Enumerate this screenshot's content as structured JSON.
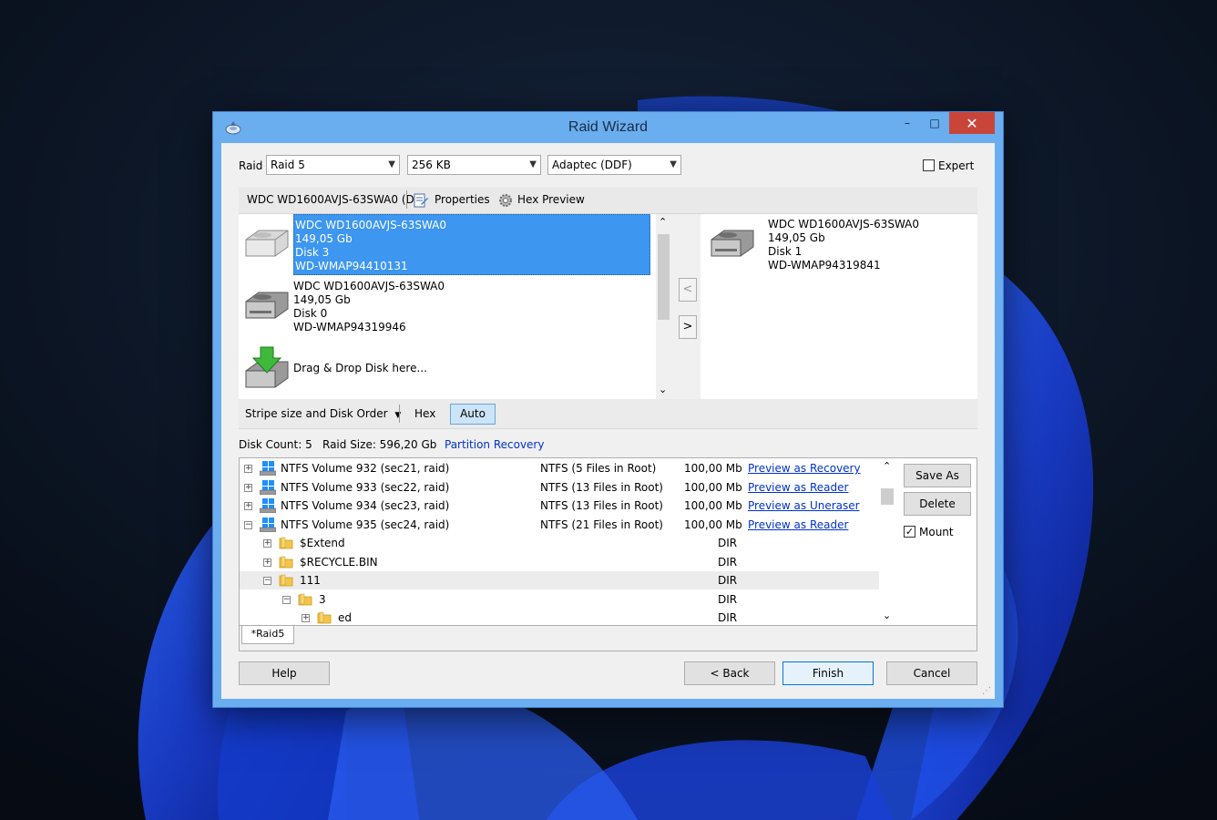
{
  "window": {
    "title": "Raid Wizard",
    "minimize": "–",
    "maximize": "□",
    "close": "✕"
  },
  "toolbar": {
    "raid_label": "Raid",
    "raid_type": "Raid 5",
    "stripe_size": "256 KB",
    "layout": "Adaptec (DDF)",
    "expert_label": "Expert",
    "expert_checked": false
  },
  "strip": {
    "disk_name": "WDC WD1600AVJS-63SWA0 (D",
    "properties_label": "Properties",
    "hex_preview_label": "Hex Preview"
  },
  "disks_left": [
    {
      "model": "WDC WD1600AVJS-63SWA0",
      "size": "149,05 Gb",
      "disk": "Disk 3",
      "serial": "WD-WMAP94410131",
      "selected": true
    },
    {
      "model": "WDC WD1600AVJS-63SWA0",
      "size": "149,05 Gb",
      "disk": "Disk 0",
      "serial": "WD-WMAP94319946",
      "selected": false
    }
  ],
  "drop_hint": "Drag & Drop Disk here...",
  "disks_right": [
    {
      "model": "WDC WD1600AVJS-63SWA0",
      "size": "149,05 Gb",
      "disk": "Disk 1",
      "serial": "WD-WMAP94319841"
    }
  ],
  "move_buttons": {
    "left": "<",
    "right": ">"
  },
  "tabs": {
    "stripe_order": "Stripe size and Disk Order",
    "hex": "Hex",
    "auto": "Auto"
  },
  "summary": {
    "disk_count": "Disk Count: 5",
    "raid_size": "Raid Size: 596,20 Gb",
    "partition_recovery": "Partition Recovery"
  },
  "tree_rows": [
    {
      "name": "NTFS Volume 932 (sec21, raid)",
      "type": "NTFS (5 Files in Root)",
      "size": "100,00 Mb",
      "action": "Preview as Recovery",
      "kind": "volume",
      "level": 0,
      "expander": "+"
    },
    {
      "name": "NTFS Volume 933 (sec22, raid)",
      "type": "NTFS (13 Files in Root)",
      "size": "100,00 Mb",
      "action": "Preview as Reader",
      "kind": "volume",
      "level": 0,
      "expander": "+"
    },
    {
      "name": "NTFS Volume 934 (sec23, raid)",
      "type": "NTFS (13 Files in Root)",
      "size": "100,00 Mb",
      "action": "Preview as Uneraser",
      "kind": "volume",
      "level": 0,
      "expander": "+"
    },
    {
      "name": "NTFS Volume 935 (sec24, raid)",
      "type": "NTFS (21 Files in Root)",
      "size": "100,00 Mb",
      "action": "Preview as Reader",
      "kind": "volume",
      "level": 0,
      "expander": "−"
    },
    {
      "name": "$Extend",
      "type": "",
      "size": "DIR",
      "action": "",
      "kind": "folder",
      "level": 1,
      "expander": "+"
    },
    {
      "name": "$RECYCLE.BIN",
      "type": "",
      "size": "DIR",
      "action": "",
      "kind": "folder",
      "level": 1,
      "expander": "+"
    },
    {
      "name": "111",
      "type": "",
      "size": "DIR",
      "action": "",
      "kind": "folder",
      "level": 1,
      "expander": "−",
      "highlight": true
    },
    {
      "name": "3",
      "type": "",
      "size": "DIR",
      "action": "",
      "kind": "folder",
      "level": 2,
      "expander": "−"
    },
    {
      "name": "ed",
      "type": "",
      "size": "DIR",
      "action": "",
      "kind": "folder",
      "level": 3,
      "expander": "+"
    }
  ],
  "side_buttons": {
    "save_as": "Save As",
    "delete": "Delete",
    "mount": "Mount",
    "mount_checked": true
  },
  "bottom_tab": "*Raid5",
  "footer": {
    "help": "Help",
    "back": "< Back",
    "finish": "Finish",
    "cancel": "Cancel"
  },
  "colors": {
    "title_bar": "#6aaeef",
    "selection": "#3d96f0",
    "close_button": "#c9453a",
    "link": "#0033cc"
  }
}
